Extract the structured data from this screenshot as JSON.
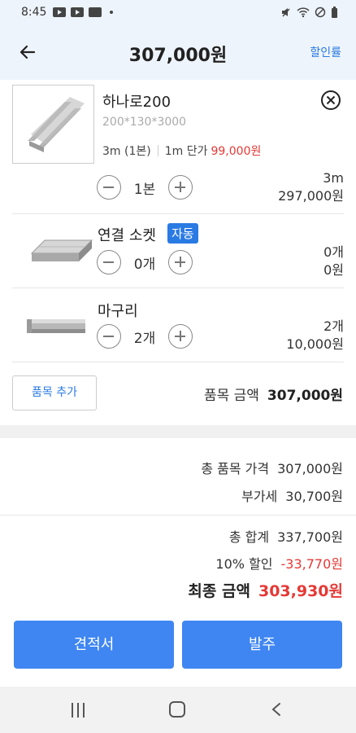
{
  "status": {
    "time": "8:45"
  },
  "header": {
    "title": "307,000원",
    "discount_link": "할인률"
  },
  "items": [
    {
      "name": "하나로200",
      "spec": "200*130*3000",
      "length": "3m (1본)",
      "unit_price_label": "1m 단가",
      "unit_price": "99,000원",
      "qty": "1본",
      "amount_qty": "3m",
      "amount": "297,000원"
    },
    {
      "name": "연결 소켓",
      "badge": "자동",
      "qty": "0개",
      "amount_qty": "0개",
      "amount": "0원"
    },
    {
      "name": "마구리",
      "qty": "2개",
      "amount_qty": "2개",
      "amount": "10,000원"
    }
  ],
  "add_item_label": "품목 추가",
  "subtotal": {
    "label": "품목 금액",
    "value": "307,000원"
  },
  "summary": {
    "total_items_label": "총 품목 가격",
    "total_items": "307,000원",
    "vat_label": "부가세",
    "vat": "30,700원",
    "total_label": "총 합계",
    "total": "337,700원",
    "discount_label": "10% 할인",
    "discount": "-33,770원",
    "final_label": "최종 금액",
    "final": "303,930원"
  },
  "buttons": {
    "quote": "견적서",
    "order": "발주"
  },
  "colors": {
    "accent": "#3f86f2",
    "link": "#2a7ae4",
    "price_red": "#e53935"
  }
}
